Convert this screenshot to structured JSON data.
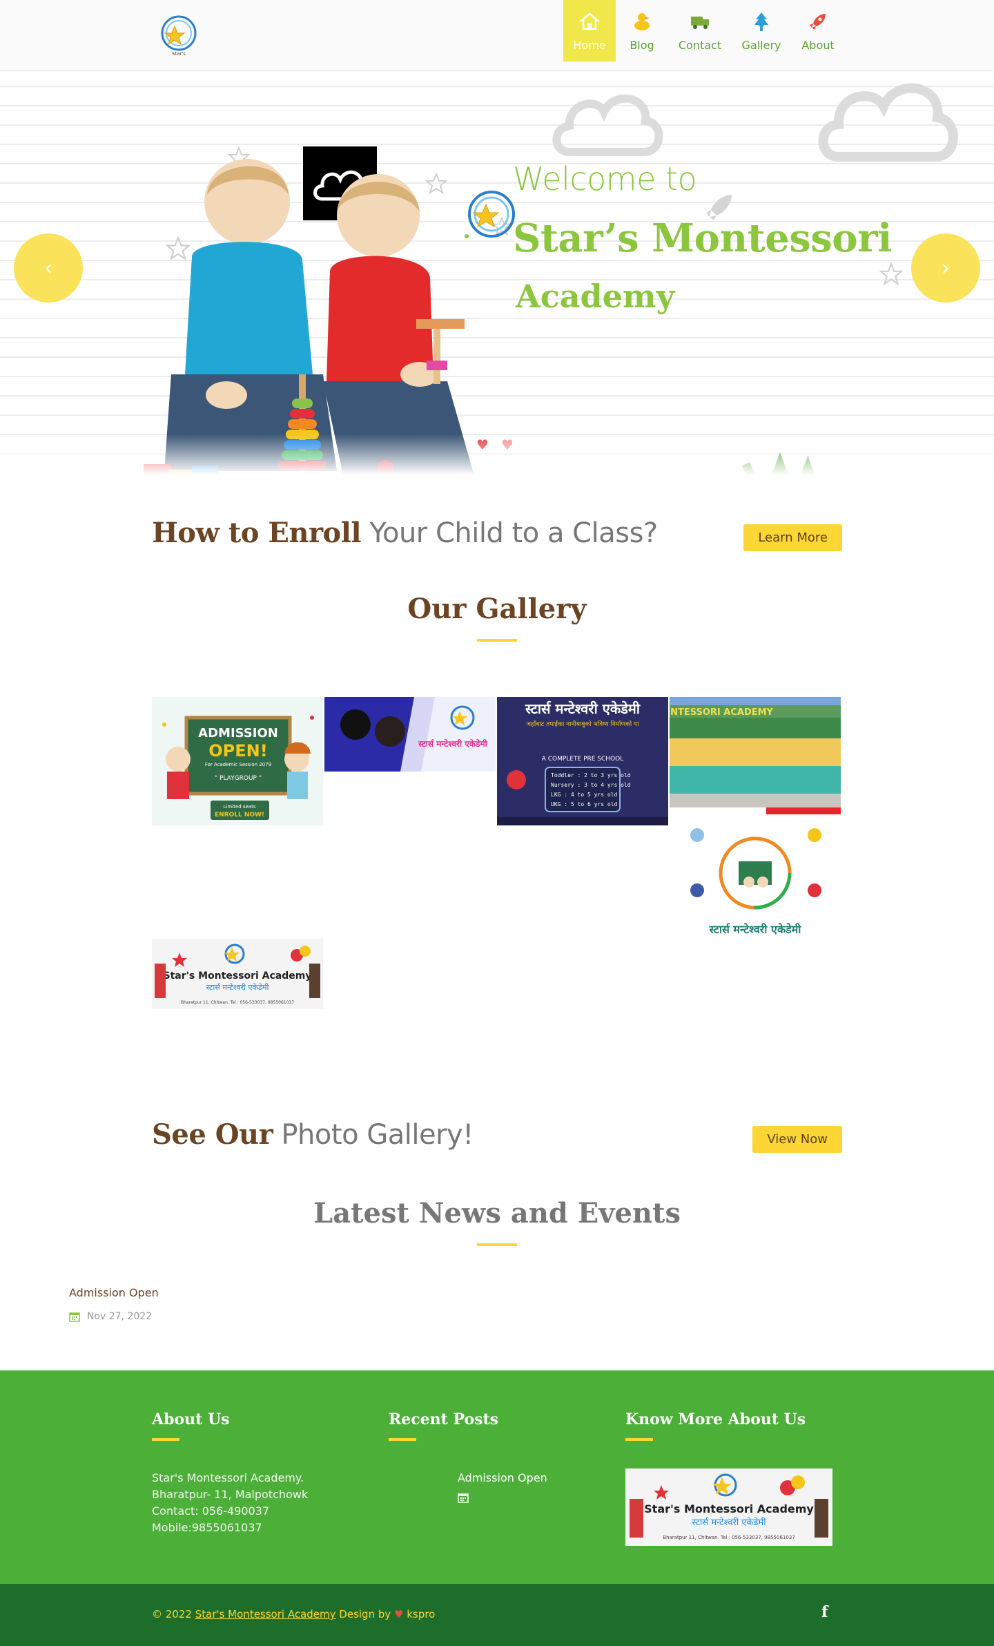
{
  "nav": {
    "items": [
      {
        "label": "Home",
        "icon": "home-icon"
      },
      {
        "label": "Blog",
        "icon": "duck-icon"
      },
      {
        "label": "Contact",
        "icon": "truck-icon"
      },
      {
        "label": "Gallery",
        "icon": "tree-icon"
      },
      {
        "label": "About",
        "icon": "rocket-icon"
      }
    ],
    "active_index": 0
  },
  "hero": {
    "welcome": "Welcome to",
    "title_line1": "Star’s Montessori",
    "title_line2": "Academy",
    "logo_text": "Star's",
    "prev_label": "‹",
    "next_label": "›"
  },
  "enroll": {
    "strong": "How to Enroll",
    "rest": " Your Child to a Class?",
    "button": "Learn More"
  },
  "gallery": {
    "title": "Our Gallery",
    "img1": {
      "line1": "ADMISSION",
      "line2": "OPEN!",
      "line3": "For Academic Session 2079",
      "line4": "\" PLAYGROUP \"",
      "line5": "Limited seats",
      "line6": "ENROLL NOW!"
    },
    "img2": {
      "text": "स्टार्स मन्टेश्वरी एकेडेमी"
    },
    "img3": {
      "heading": "स्टार्स मन्टेश्वरी एकेडेमी",
      "sub": "जहाँबाट तपाईंका नानीबाबुको भविष्य निर्माणको पा",
      "banner": "A COMPLETE PRE SCHOOL",
      "rows": [
        "Toddler  :  2 to 3 yrs old",
        "Nursery  :  3 to 4 yrs old",
        "LKG      :  4 to 5 yrs old",
        "UKG      :  5 to 6 yrs old"
      ]
    },
    "img4": {
      "sign": "ONTESSORI ACADEMY"
    },
    "img5": {
      "caption": "स्टार्स मन्टेश्वरी एकेडेमी"
    },
    "img6": {
      "title": "Star's Montessori Academy",
      "sub": "स्टार्स मन्टेश्वरी एकेडेमी",
      "address": "Bharatpur 11, Chitwan. Tel : 056-533037, 9855061037"
    }
  },
  "photo_gallery": {
    "strong": "See Our",
    "rest": " Photo Gallery!",
    "button": "View Now"
  },
  "news": {
    "title": "Latest News and Events",
    "item_title": "Admission Open",
    "item_date": "Nov 27, 2022"
  },
  "footer": {
    "about_title": "About Us",
    "about_lines": [
      "Star's Montessori Academy.",
      "Bharatpur- 11, Malpotchowk",
      "Contact: 056-490037",
      "Mobile:9855061037"
    ],
    "recent_title": "Recent Posts",
    "recent_item": "Admission Open",
    "know_title": "Know More About Us",
    "know_img": {
      "title": "Star's Montessori Academy",
      "sub": "स्टार्स मन्टेश्वरी एकेडेमी",
      "address": "Bharatpur 11, Chitwan. Tel : 056-533037, 9855061037"
    },
    "copy_prefix": "© 2022 ",
    "copy_link": "Star's Montessori Academy",
    "copy_middle": " Design by ",
    "copy_suffix": " kspro",
    "facebook": "f"
  },
  "colors": {
    "brand_green": "#8cc63f",
    "footer_green": "#4cb038",
    "dark_green": "#1e6e2b",
    "accent_yellow": "#fbd634",
    "brown": "#6b4423"
  }
}
